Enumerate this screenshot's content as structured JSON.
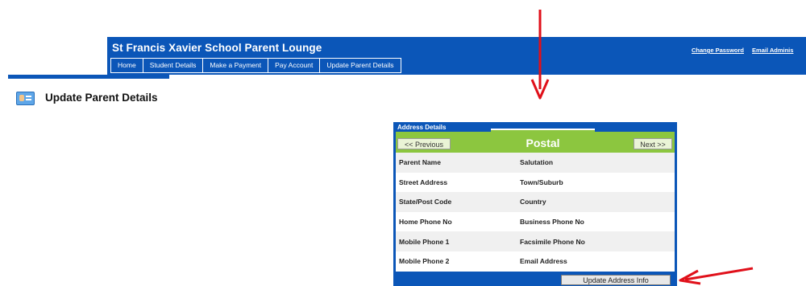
{
  "header": {
    "title": "St Francis Xavier School Parent Lounge",
    "nav": [
      "Home",
      "Student Details",
      "Make a Payment",
      "Pay Account",
      "Update Parent Details"
    ],
    "links": {
      "change_password": "Change Password",
      "email_admin": "Email Adminis"
    }
  },
  "page": {
    "title": "Update Parent Details",
    "icon": "id-card-icon"
  },
  "panel": {
    "heading": "Address Details",
    "tab_label": "Postal",
    "previous_label": "<< Previous",
    "next_label": "Next >>",
    "rows": [
      [
        "Parent Name",
        "Salutation"
      ],
      [
        "Street Address",
        "Town/Suburb"
      ],
      [
        "State/Post Code",
        "Country"
      ],
      [
        "Home Phone No",
        "Business Phone No"
      ],
      [
        "Mobile Phone 1",
        "Facsimile Phone No"
      ],
      [
        "Mobile Phone 2",
        "Email Address"
      ]
    ],
    "update_button": "Update Address Info"
  },
  "colors": {
    "header_blue": "#0b56b8",
    "tab_green": "#8cc63f",
    "arrow_red": "#e0101a"
  }
}
